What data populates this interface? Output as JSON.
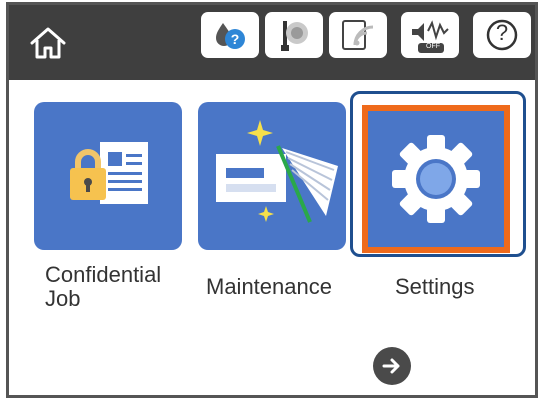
{
  "topbar": {
    "home_icon": "home-icon",
    "status_icons": [
      "ink-status-icon",
      "network-status-icon",
      "wifi-direct-icon",
      "quiet-mode-icon",
      "help-icon"
    ],
    "quiet_mode_badge": "OFF",
    "help_symbol": "?"
  },
  "tiles": [
    {
      "label": "Confidential Job",
      "icon": "lock-document-icon"
    },
    {
      "label": "Maintenance",
      "icon": "printhead-cleaning-icon"
    },
    {
      "label": "Settings",
      "icon": "gear-icon",
      "selected": true
    }
  ],
  "labels": {
    "confidential_line1": "Confidential",
    "confidential_line2": "Job",
    "maintenance": "Maintenance",
    "settings": "Settings"
  },
  "colors": {
    "topbar": "#3f3f3f",
    "tile": "#4a76c7",
    "selection_outline": "#1f4f8f",
    "selection_inner": "#ef6a1b"
  },
  "pager": {
    "next_icon": "arrow-right-icon"
  }
}
